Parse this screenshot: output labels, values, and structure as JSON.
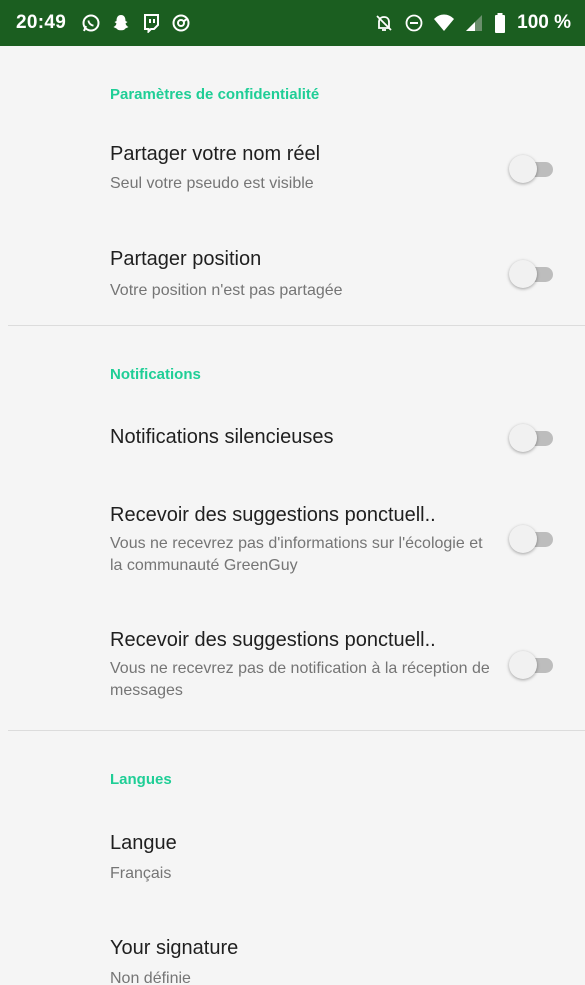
{
  "status_bar": {
    "time": "20:49",
    "battery": "100 %",
    "left_icons": [
      "whatsapp-icon",
      "snapchat-icon",
      "twitch-icon",
      "app-circle-icon"
    ],
    "right_icons": [
      "alarm-off-icon",
      "do-not-disturb-icon",
      "wifi-icon",
      "signal-icon",
      "battery-icon"
    ],
    "background": "#1b5e20"
  },
  "accent_color": "#1fce96",
  "sections": {
    "privacy": {
      "header": "Paramètres de confidentialité",
      "items": [
        {
          "title": "Partager votre nom réel",
          "subtitle": "Seul votre pseudo est visible",
          "toggle": "off"
        },
        {
          "title": "Partager position",
          "subtitle": "Votre position n'est pas partagée",
          "toggle": "off"
        }
      ]
    },
    "notifications": {
      "header": "Notifications",
      "items": [
        {
          "title": "Notifications silencieuses",
          "toggle": "off"
        },
        {
          "title": "Recevoir des suggestions ponctuell..",
          "subtitle": "Vous ne recevrez pas d'informations sur l'écologie et la communauté GreenGuy",
          "toggle": "off"
        },
        {
          "title": "Recevoir des suggestions ponctuell..",
          "subtitle": "Vous ne recevrez pas de notification à la réception de messages",
          "toggle": "off"
        }
      ]
    },
    "languages": {
      "header": "Langues",
      "items": [
        {
          "title": "Langue",
          "subtitle": "Français"
        },
        {
          "title": "Your signature",
          "subtitle": "Non définie"
        }
      ]
    }
  }
}
